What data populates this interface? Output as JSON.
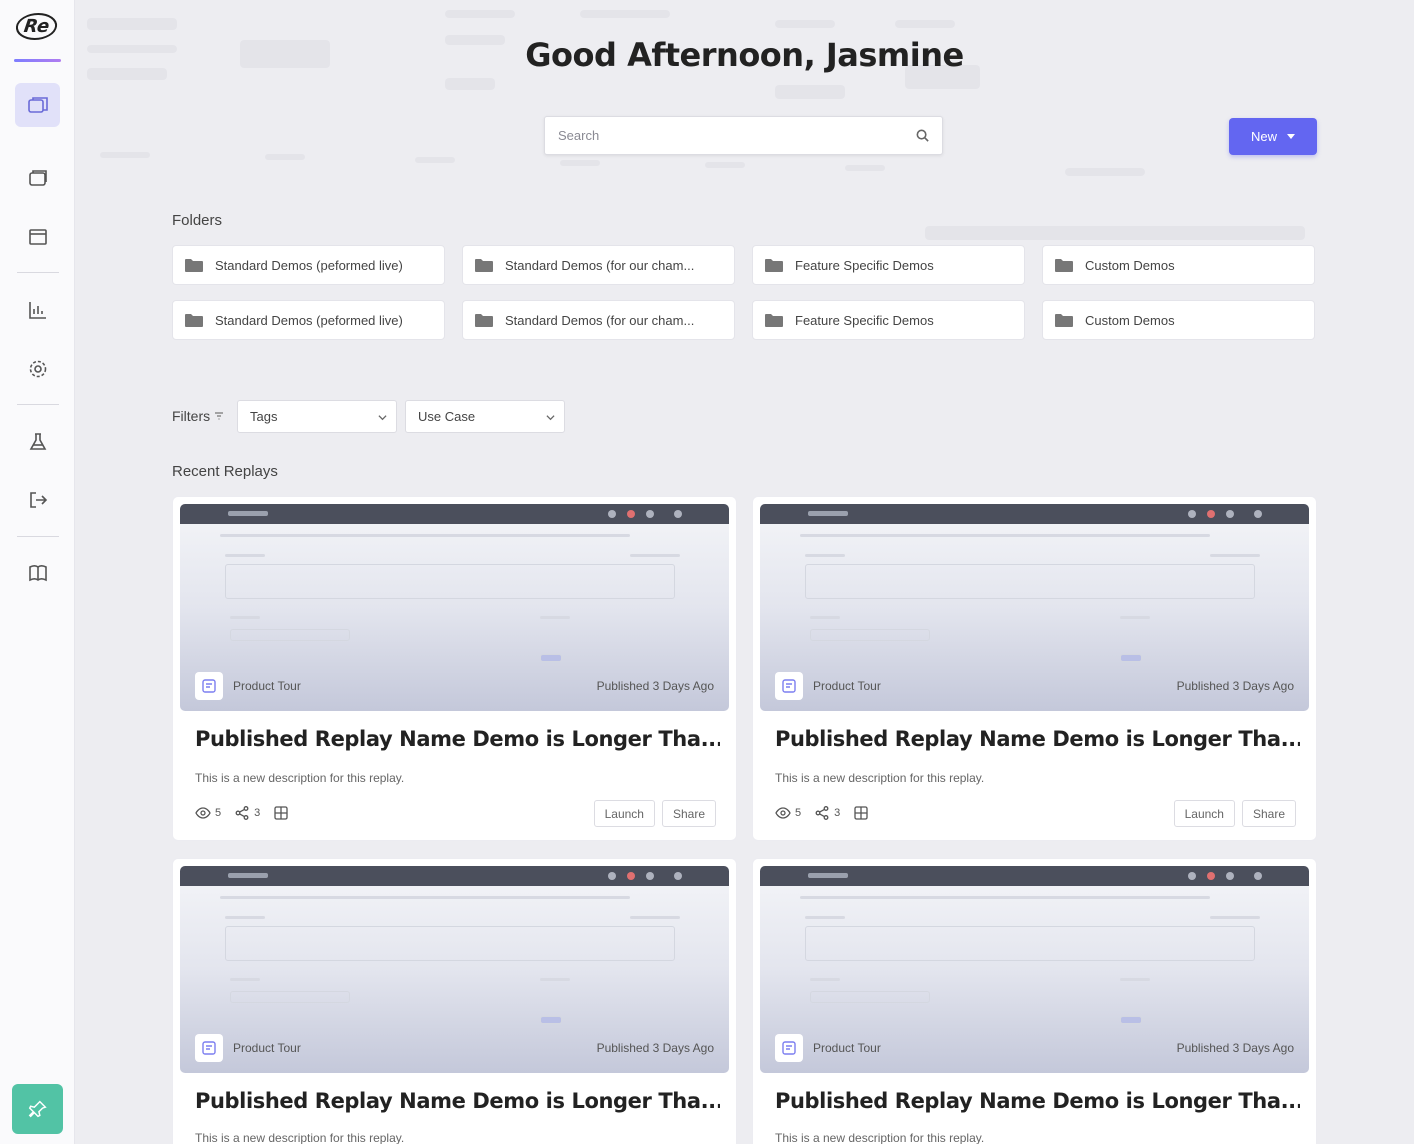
{
  "app": {
    "logo_text": "Re"
  },
  "sidebar": {
    "items": [
      {
        "name": "replays",
        "icon": "folders-icon",
        "active": true
      },
      {
        "name": "windows",
        "icon": "window-icon",
        "active": false
      },
      {
        "name": "browser",
        "icon": "browser-icon",
        "active": false
      },
      {
        "name": "analytics",
        "icon": "bar-chart-icon",
        "active": false
      },
      {
        "name": "settings",
        "icon": "gear-icon",
        "active": false
      },
      {
        "name": "lab",
        "icon": "flask-icon",
        "active": false
      },
      {
        "name": "logout",
        "icon": "logout-icon",
        "active": false
      },
      {
        "name": "docs",
        "icon": "book-icon",
        "active": false
      }
    ],
    "bottom_icon": "pin-icon",
    "accent_color": "#52c3a5"
  },
  "header": {
    "greeting": "Good Afternoon, Jasmine",
    "search_placeholder": "Search",
    "new_button_label": "New"
  },
  "folders": {
    "label": "Folders",
    "items": [
      "Standard Demos (peformed live)",
      "Standard Demos (for our cham...",
      "Feature Specific Demos",
      "Custom Demos",
      "Standard Demos (peformed live)",
      "Standard Demos (for our cham...",
      "Feature Specific Demos",
      "Custom Demos"
    ]
  },
  "filters": {
    "label": "Filters",
    "tags_label": "Tags",
    "use_case_label": "Use Case"
  },
  "recent": {
    "label": "Recent Replays",
    "cards": [
      {
        "type": "Product Tour",
        "published": "Published 3 Days Ago",
        "title": "Published Replay Name Demo is Longer Tha...",
        "description": "This is a new description for this replay.",
        "views": "5",
        "shares": "3",
        "launch_label": "Launch",
        "share_label": "Share"
      },
      {
        "type": "Product Tour",
        "published": "Published 3 Days Ago",
        "title": "Published Replay Name Demo is Longer Tha...",
        "description": "This is a new description for this replay.",
        "views": "5",
        "shares": "3",
        "launch_label": "Launch",
        "share_label": "Share"
      },
      {
        "type": "Product Tour",
        "published": "Published 3 Days Ago",
        "title": "Published Replay Name Demo is Longer Tha...",
        "description": "This is a new description for this replay."
      },
      {
        "type": "Product Tour",
        "published": "Published 3 Days Ago",
        "title": "Published Replay Name Demo is Longer Tha...",
        "description": "This is a new description for this replay."
      }
    ]
  },
  "colors": {
    "primary": "#6366f1",
    "active_nav_bg": "#e1e1f9"
  }
}
